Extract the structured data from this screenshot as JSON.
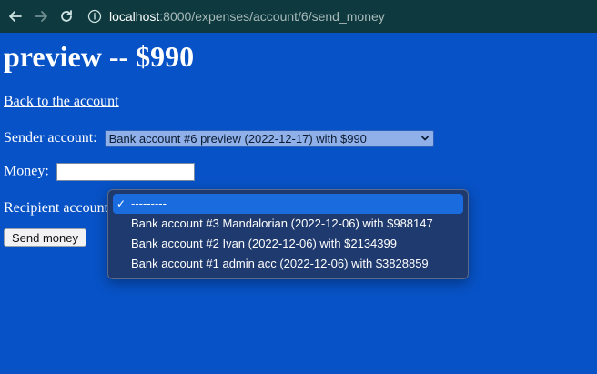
{
  "browser": {
    "url_host": "localhost",
    "url_path": ":8000/expenses/account/6/send_money"
  },
  "page": {
    "title": "preview -- $990",
    "back_link": "Back to the account",
    "sender_label": "Sender account:",
    "sender_selected": "Bank account #6 preview (2022-12-17) with $990",
    "money_label": "Money:",
    "money_value": "",
    "recipient_label": "Recipient account",
    "send_button": "Send money"
  },
  "dropdown": {
    "items": [
      {
        "label": "---------",
        "selected": true
      },
      {
        "label": "Bank account #3 Mandalorian (2022-12-06) with $988147",
        "selected": false
      },
      {
        "label": "Bank account #2 Ivan (2022-12-06) with $2134399",
        "selected": false
      },
      {
        "label": "Bank account #1 admin acc (2022-12-06) with $3828859",
        "selected": false
      }
    ]
  },
  "colors": {
    "page_background": "#0752c6",
    "browser_bar": "#0e3a3f",
    "dropdown_selected": "#1a6cde"
  }
}
